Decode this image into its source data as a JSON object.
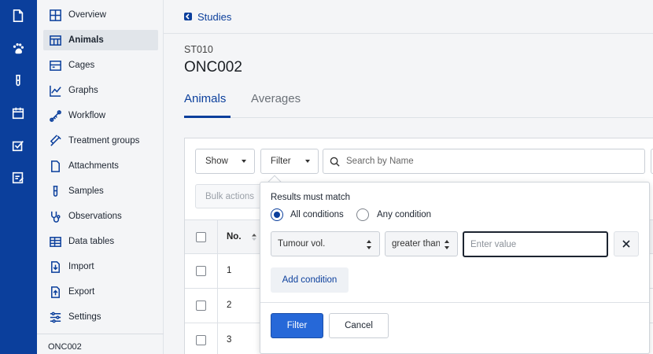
{
  "rail": {
    "icons": [
      "document-icon",
      "paw-icon",
      "test-tube-icon",
      "calendar-icon",
      "checklist-icon",
      "notes-icon"
    ]
  },
  "sidebar": {
    "items": [
      {
        "label": "Overview",
        "icon": "overview-icon"
      },
      {
        "label": "Animals",
        "icon": "table-icon",
        "active": true
      },
      {
        "label": "Cages",
        "icon": "cages-icon"
      },
      {
        "label": "Graphs",
        "icon": "graph-icon"
      },
      {
        "label": "Workflow",
        "icon": "workflow-icon"
      },
      {
        "label": "Treatment groups",
        "icon": "syringe-icon"
      },
      {
        "label": "Attachments",
        "icon": "attachment-icon"
      },
      {
        "label": "Samples",
        "icon": "test-tube-icon"
      },
      {
        "label": "Observations",
        "icon": "stethoscope-icon"
      },
      {
        "label": "Data tables",
        "icon": "data-table-icon"
      },
      {
        "label": "Import",
        "icon": "import-icon"
      },
      {
        "label": "Export",
        "icon": "export-icon"
      },
      {
        "label": "Settings",
        "icon": "settings-icon"
      }
    ],
    "footer": "ONC002"
  },
  "header": {
    "back_label": "Studies",
    "study_code": "ST010",
    "study_title": "ONC002"
  },
  "tabs": [
    {
      "label": "Animals",
      "active": true
    },
    {
      "label": "Averages",
      "active": false
    }
  ],
  "toolbar": {
    "show_label": "Show",
    "filter_label": "Filter",
    "search_placeholder": "Search by Name",
    "bulk_label": "Bulk actions"
  },
  "table": {
    "columns": [
      "No."
    ],
    "rows": [
      "1",
      "2",
      "3"
    ]
  },
  "filter_popover": {
    "title": "Results must match",
    "options": [
      "All conditions",
      "Any condition"
    ],
    "selected_option": "All conditions",
    "field_value": "Tumour vol.",
    "operator_value": "greater than",
    "value_placeholder": "Enter value",
    "add_condition_label": "Add condition",
    "apply_label": "Filter",
    "cancel_label": "Cancel"
  },
  "colors": {
    "brand": "#0b3f9c",
    "primary_button": "#2668d8"
  }
}
